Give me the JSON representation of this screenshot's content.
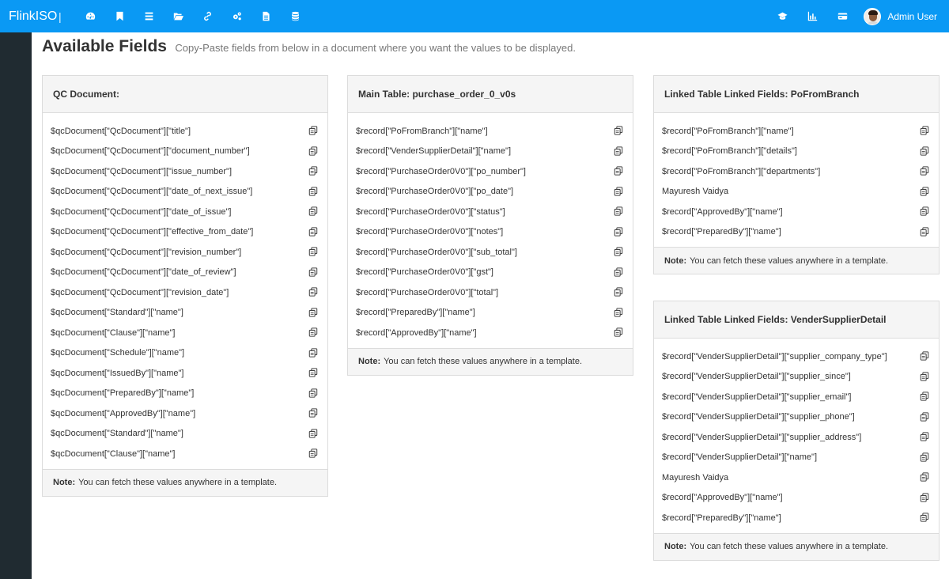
{
  "app": {
    "brand": "FlinkISO",
    "separator": "|",
    "nav_icons": [
      "dashboard-icon",
      "bookmark-icon",
      "list-icon",
      "folder-open-icon",
      "link-icon",
      "cogs-icon",
      "file-icon",
      "database-icon"
    ],
    "right_icons": [
      "graduation-cap-icon",
      "bar-chart-icon",
      "credit-card-icon"
    ],
    "user_name": "Admin User",
    "accent_color": "#0a99f4",
    "sidebar_color": "#202b31"
  },
  "page": {
    "title": "Available Fields",
    "subtitle": "Copy-Paste fields from below in a document where you want the values to be displayed."
  },
  "note": {
    "label": "Note:",
    "text": "You can fetch these values anywhere in a template."
  },
  "panels": {
    "qc": {
      "title": "QC Document:",
      "fields": [
        "$qcDocument[\"QcDocument\"][\"title\"]",
        "$qcDocument[\"QcDocument\"][\"document_number\"]",
        "$qcDocument[\"QcDocument\"][\"issue_number\"]",
        "$qcDocument[\"QcDocument\"][\"date_of_next_issue\"]",
        "$qcDocument[\"QcDocument\"][\"date_of_issue\"]",
        "$qcDocument[\"QcDocument\"][\"effective_from_date\"]",
        "$qcDocument[\"QcDocument\"][\"revision_number\"]",
        "$qcDocument[\"QcDocument\"][\"date_of_review\"]",
        "$qcDocument[\"QcDocument\"][\"revision_date\"]",
        "$qcDocument[\"Standard\"][\"name\"]",
        "$qcDocument[\"Clause\"][\"name\"]",
        "$qcDocument[\"Schedule\"][\"name\"]",
        "$qcDocument[\"IssuedBy\"][\"name\"]",
        "$qcDocument[\"PreparedBy\"][\"name\"]",
        "$qcDocument[\"ApprovedBy\"][\"name\"]",
        "$qcDocument[\"Standard\"][\"name\"]",
        "$qcDocument[\"Clause\"][\"name\"]"
      ]
    },
    "main": {
      "title": "Main Table: purchase_order_0_v0s",
      "fields": [
        "$record[\"PoFromBranch\"][\"name\"]",
        "$record[\"VenderSupplierDetail\"][\"name\"]",
        "$record[\"PurchaseOrder0V0\"][\"po_number\"]",
        "$record[\"PurchaseOrder0V0\"][\"po_date\"]",
        "$record[\"PurchaseOrder0V0\"][\"status\"]",
        "$record[\"PurchaseOrder0V0\"][\"notes\"]",
        "$record[\"PurchaseOrder0V0\"][\"sub_total\"]",
        "$record[\"PurchaseOrder0V0\"][\"gst\"]",
        "$record[\"PurchaseOrder0V0\"][\"total\"]",
        "$record[\"PreparedBy\"][\"name\"]",
        "$record[\"ApprovedBy\"][\"name\"]"
      ]
    },
    "branch": {
      "title": "Linked Table Linked Fields: PoFromBranch",
      "fields": [
        "$record[\"PoFromBranch\"][\"name\"]",
        "$record[\"PoFromBranch\"][\"details\"]",
        "$record[\"PoFromBranch\"][\"departments\"]",
        "Mayuresh Vaidya",
        "$record[\"ApprovedBy\"][\"name\"]",
        "$record[\"PreparedBy\"][\"name\"]"
      ]
    },
    "vender": {
      "title": "Linked Table Linked Fields: VenderSupplierDetail",
      "fields": [
        "$record[\"VenderSupplierDetail\"][\"supplier_company_type\"]",
        "$record[\"VenderSupplierDetail\"][\"supplier_since\"]",
        "$record[\"VenderSupplierDetail\"][\"supplier_email\"]",
        "$record[\"VenderSupplierDetail\"][\"supplier_phone\"]",
        "$record[\"VenderSupplierDetail\"][\"supplier_address\"]",
        "$record[\"VenderSupplierDetail\"][\"name\"]",
        "Mayuresh Vaidya",
        "$record[\"ApprovedBy\"][\"name\"]",
        "$record[\"PreparedBy\"][\"name\"]"
      ]
    }
  }
}
